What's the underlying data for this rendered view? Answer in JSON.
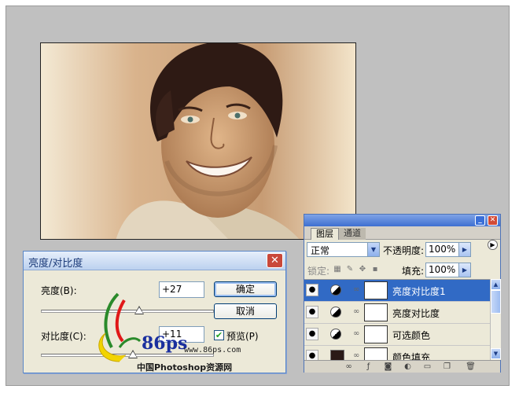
{
  "bc_dialog": {
    "title": "亮度/对比度",
    "close_label": "✕",
    "brightness_label": "亮度(B):",
    "brightness_value": "+27",
    "brightness_slider_fraction": 0.57,
    "contrast_label": "对比度(C):",
    "contrast_value": "+11",
    "contrast_slider_fraction": 0.53,
    "ok_label": "确定",
    "cancel_label": "取消",
    "preview_label": "预览(P)",
    "preview_checked": true
  },
  "watermark": {
    "brand_number": "86ps",
    "site": "www.86ps.com",
    "site_name": "中国Photoshop资源网"
  },
  "layers_panel": {
    "tabs": [
      "图层",
      "通道"
    ],
    "active_tab": 0,
    "blend_mode": "正常",
    "opacity_label": "不透明度:",
    "opacity_value": "100%",
    "lock_label": "锁定:",
    "fill_label": "填充:",
    "fill_value": "100%",
    "layers": [
      {
        "name": "亮度对比度1",
        "kind": "adjustment",
        "selected": true
      },
      {
        "name": "亮度对比度",
        "kind": "adjustment",
        "selected": false
      },
      {
        "name": "可选颜色",
        "kind": "adjustment",
        "selected": false
      },
      {
        "name": "颜色填充",
        "kind": "fill",
        "selected": false
      }
    ],
    "fill_color": "#2a1a17",
    "selection_color": "#316ac5"
  },
  "colors": {
    "workspace": "#c0c0c0",
    "dialog_bg": "#ece9d8",
    "title_text": "#1b3a78",
    "close_red": "#c9483a"
  },
  "icons": [
    "close-icon",
    "checkmark-icon",
    "eye-icon",
    "adjustment-icon",
    "link-icon",
    "dropdown-arrow-icon",
    "lock-icon",
    "brush-icon",
    "move-icon",
    "panel-menu-icon",
    "minimize-icon",
    "scroll-up-icon",
    "scroll-down-icon",
    "new-layer-icon",
    "trash-icon",
    "fx-icon",
    "mask-icon",
    "folder-icon"
  ]
}
